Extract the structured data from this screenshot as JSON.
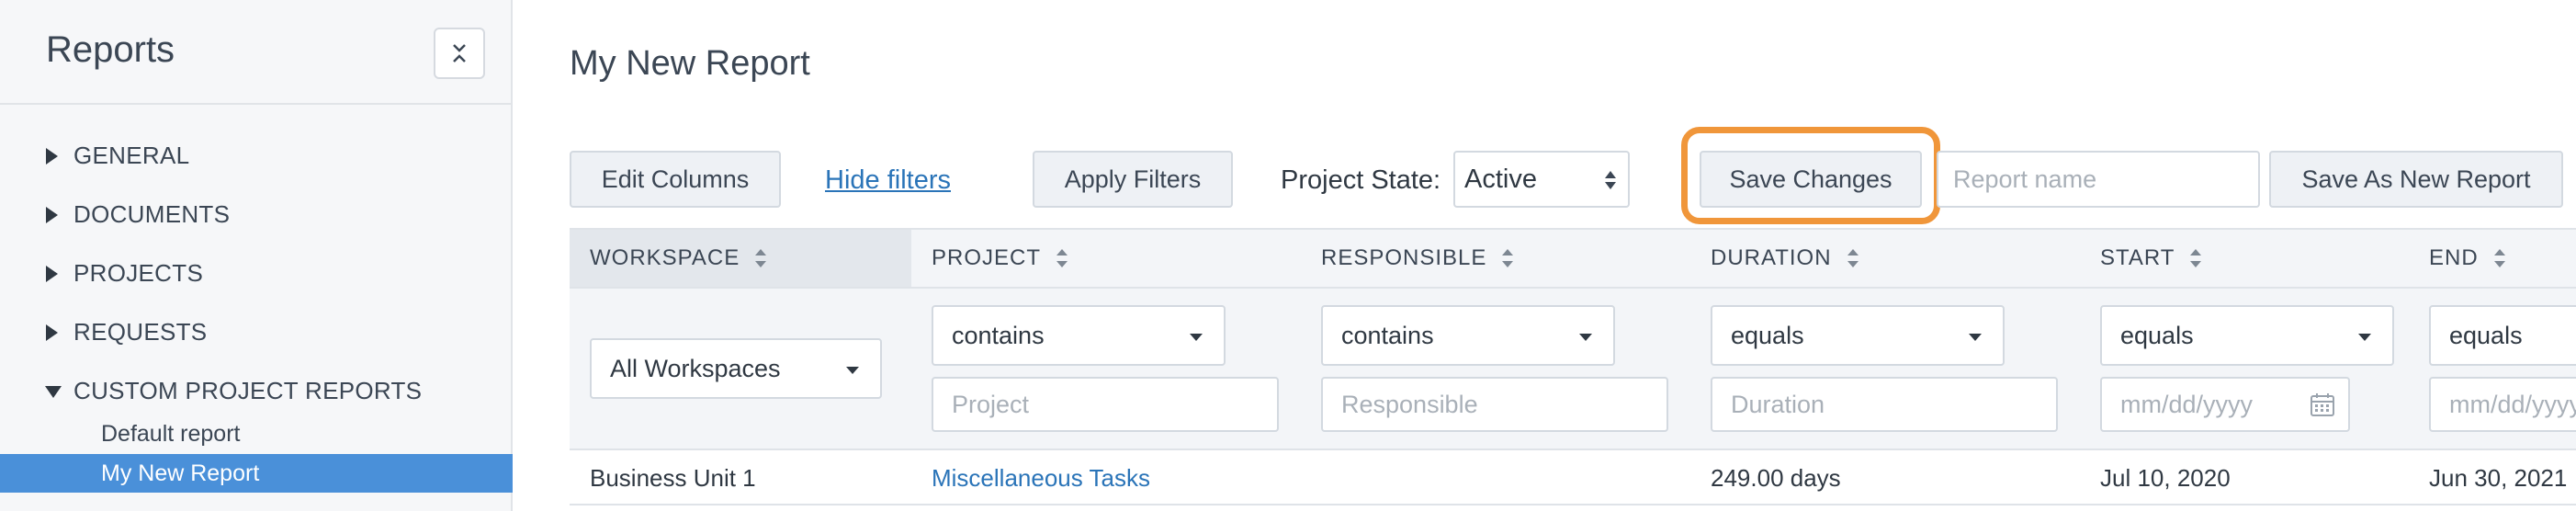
{
  "sidebar": {
    "title": "Reports",
    "sections": [
      {
        "label": "GENERAL",
        "expanded": false
      },
      {
        "label": "DOCUMENTS",
        "expanded": false
      },
      {
        "label": "PROJECTS",
        "expanded": false
      },
      {
        "label": "REQUESTS",
        "expanded": false
      },
      {
        "label": "CUSTOM PROJECT REPORTS",
        "expanded": true
      }
    ],
    "sub_items": [
      {
        "label": "Default report",
        "active": false
      },
      {
        "label": "My New Report",
        "active": true
      }
    ]
  },
  "main": {
    "title": "My New Report",
    "toolbar": {
      "edit_columns": "Edit Columns",
      "hide_filters": "Hide filters",
      "apply_filters": "Apply Filters",
      "project_state_label": "Project State:",
      "project_state_value": "Active",
      "save_changes": "Save Changes",
      "report_name_placeholder": "Report name",
      "save_as_new": "Save As New Report"
    },
    "columns": [
      "WORKSPACE",
      "PROJECT",
      "RESPONSIBLE",
      "DURATION",
      "START",
      "END"
    ],
    "filters": {
      "workspace": "All Workspaces",
      "project_op": "contains",
      "project_placeholder": "Project",
      "responsible_op": "contains",
      "responsible_placeholder": "Responsible",
      "duration_op": "equals",
      "duration_placeholder": "Duration",
      "start_op": "equals",
      "start_placeholder": "mm/dd/yyyy",
      "end_op": "equals",
      "end_placeholder": "mm/dd/yyyy"
    },
    "rows": [
      {
        "workspace": "Business Unit 1",
        "project": "Miscellaneous Tasks",
        "responsible": "",
        "duration": "249.00 days",
        "start": "Jul 10, 2020",
        "end": "Jun 30, 2021"
      }
    ]
  },
  "colors": {
    "accent": "#4a90d9",
    "link": "#2a74b8",
    "highlight": "#f0963a"
  }
}
